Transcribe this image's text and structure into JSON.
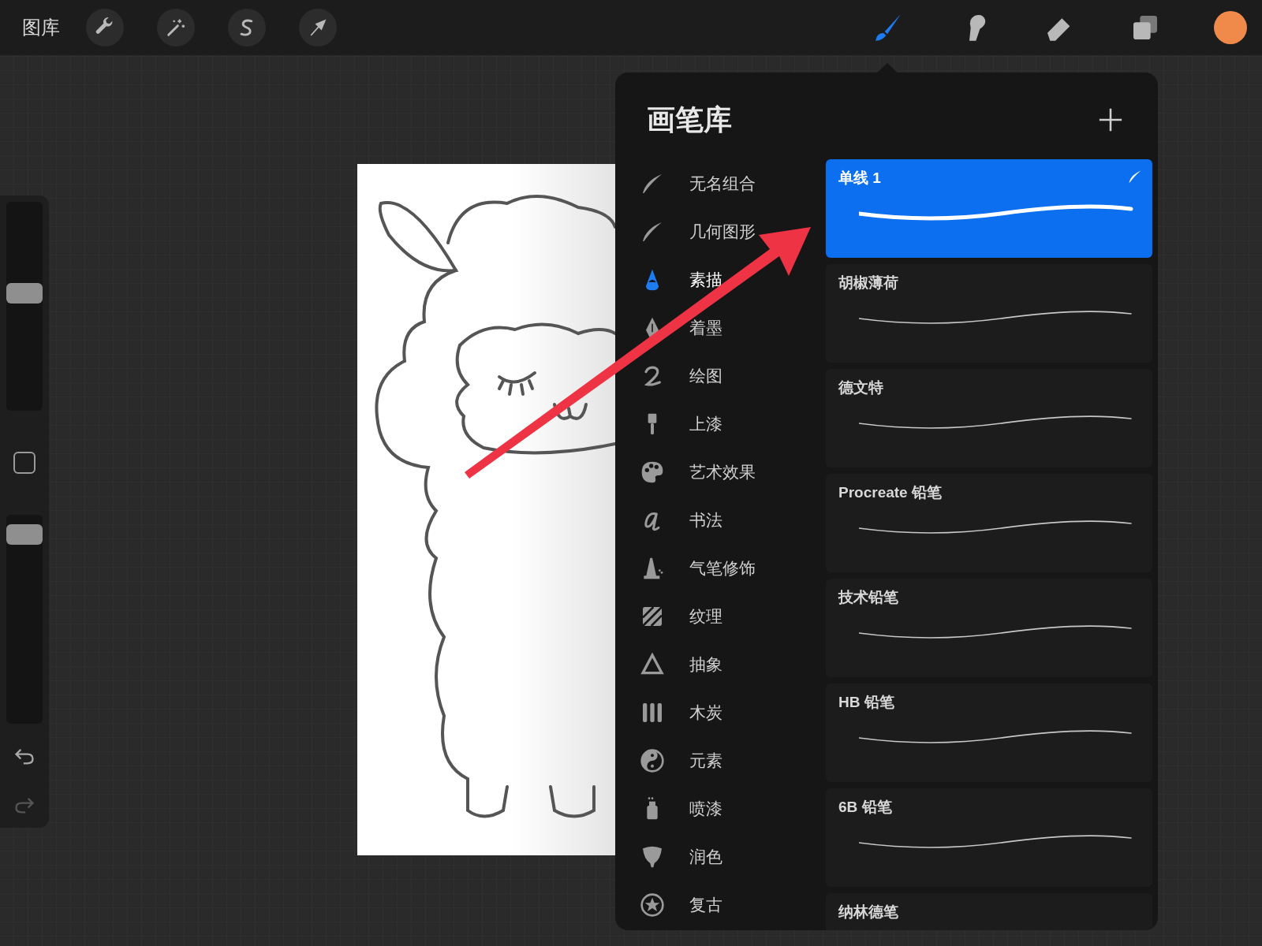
{
  "toolbar": {
    "gallery": "图库",
    "tools": [
      {
        "kind": "wrench",
        "selected": false
      },
      {
        "kind": "wand",
        "selected": false
      },
      {
        "kind": "selection",
        "selected": false
      },
      {
        "kind": "move",
        "selected": false
      }
    ],
    "painting_tools": [
      {
        "kind": "brush",
        "selected": true
      },
      {
        "kind": "smudge",
        "selected": false
      },
      {
        "kind": "eraser",
        "selected": false
      },
      {
        "kind": "layers",
        "selected": false
      }
    ],
    "color_swatch": {
      "color": "#ef8a4a"
    }
  },
  "sidebar": {
    "sliders": [
      {
        "level": 0.57
      },
      {
        "level": 0.95
      }
    ]
  },
  "brush_library": {
    "title": "画笔库",
    "categories": [
      {
        "label": "无名组合",
        "kind": "swoosh",
        "selected": false
      },
      {
        "label": "几何图形",
        "kind": "swoosh",
        "selected": false
      },
      {
        "label": "素描",
        "kind": "pencil",
        "selected": true
      },
      {
        "label": "着墨",
        "kind": "nib",
        "selected": false
      },
      {
        "label": "绘图",
        "kind": "curl",
        "selected": false
      },
      {
        "label": "上漆",
        "kind": "paintbrush",
        "selected": false
      },
      {
        "label": "艺术效果",
        "kind": "palette",
        "selected": false
      },
      {
        "label": "书法",
        "kind": "script",
        "selected": false
      },
      {
        "label": "气笔修饰",
        "kind": "airbrush",
        "selected": false
      },
      {
        "label": "纹理",
        "kind": "hatch",
        "selected": false
      },
      {
        "label": "抽象",
        "kind": "triangle",
        "selected": false
      },
      {
        "label": "木炭",
        "kind": "bars",
        "selected": false
      },
      {
        "label": "元素",
        "kind": "yinyang",
        "selected": false
      },
      {
        "label": "喷漆",
        "kind": "spray",
        "selected": false
      },
      {
        "label": "润色",
        "kind": "blob",
        "selected": false
      },
      {
        "label": "复古",
        "kind": "star",
        "selected": false
      }
    ],
    "brushes": [
      {
        "name": "单线 1",
        "selected": true
      },
      {
        "name": "胡椒薄荷",
        "selected": false
      },
      {
        "name": "德文特",
        "selected": false
      },
      {
        "name": "Procreate 铅笔",
        "selected": false
      },
      {
        "name": "技术铅笔",
        "selected": false
      },
      {
        "name": "HB 铅笔",
        "selected": false
      },
      {
        "name": "6B 铅笔",
        "selected": false
      },
      {
        "name": "纳林德笔",
        "selected": false
      }
    ]
  }
}
